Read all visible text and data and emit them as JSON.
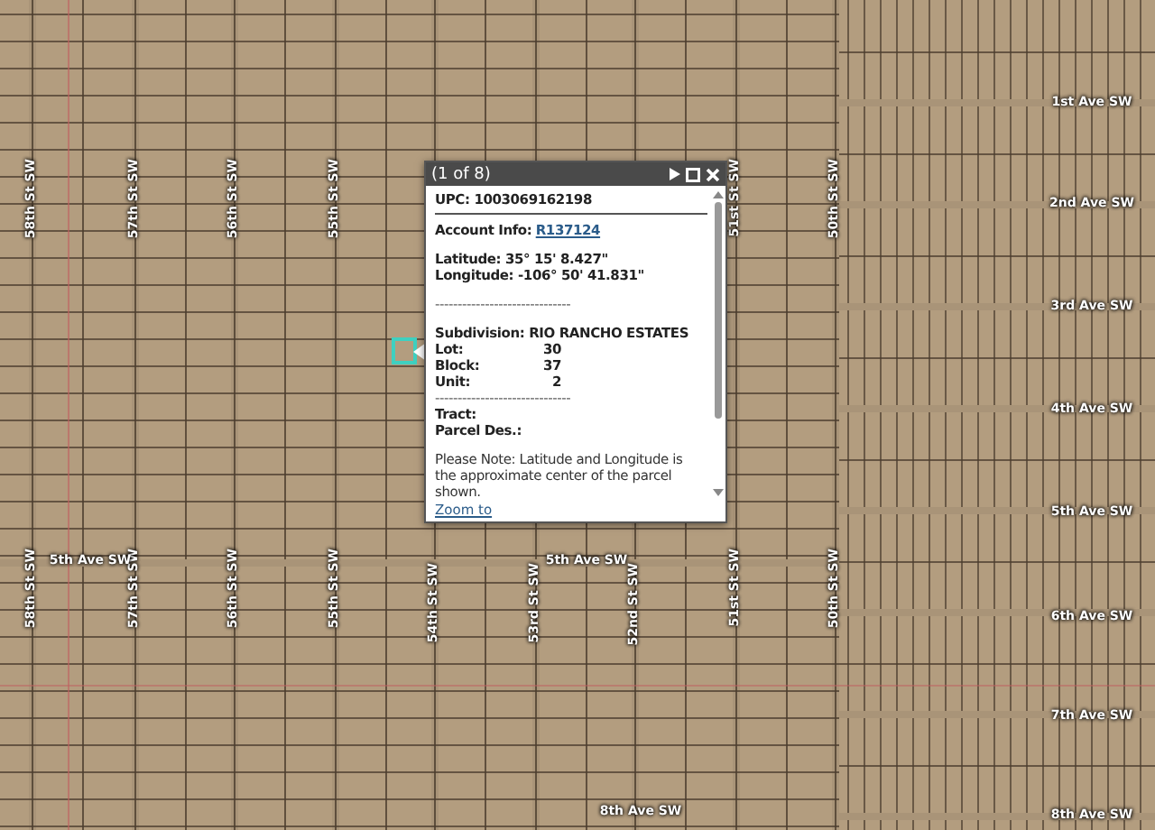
{
  "map": {
    "street_labels_upper": [
      "58th St SW",
      "57th St SW",
      "56th St SW",
      "55th St SW",
      "51st St SW",
      "50th St SW"
    ],
    "street_labels_lower": [
      "58th St SW",
      "57th St SW",
      "56th St SW",
      "55th St SW",
      "54th St SW",
      "53rd St SW",
      "52nd St SW",
      "51st St SW",
      "50th St SW"
    ],
    "avenue_labels": [
      "1st Ave SW",
      "2nd Ave SW",
      "3rd Ave SW",
      "4th Ave SW",
      "5th Ave SW",
      "6th Ave SW",
      "7th Ave SW",
      "8th Ave SW",
      "5th Ave SW",
      "5th Ave SW",
      "8th Ave SW"
    ]
  },
  "popup": {
    "title": "(1 of 8)",
    "rows": [
      {
        "kind": "field",
        "label": "UPC:",
        "value": "1003069162198"
      },
      {
        "kind": "rule"
      },
      {
        "kind": "link",
        "label": "Account Info:",
        "value": "R137124"
      },
      {
        "kind": "gap"
      },
      {
        "kind": "field",
        "label": "Latitude:",
        "value": "35° 15' 8.427\""
      },
      {
        "kind": "field",
        "label": "Longitude:",
        "value": "-106° 50' 41.831\""
      },
      {
        "kind": "gap"
      },
      {
        "kind": "dashes",
        "text": "------------------------------"
      },
      {
        "kind": "gap"
      },
      {
        "kind": "field",
        "label": "Subdivision:",
        "value": "RIO RANCHO ESTATES"
      },
      {
        "kind": "pair",
        "label": "Lot:",
        "value": "30"
      },
      {
        "kind": "pair",
        "label": "Block:",
        "value": "37"
      },
      {
        "kind": "pair",
        "label": "Unit:",
        "value": "2"
      },
      {
        "kind": "dashes",
        "text": "------------------------------"
      },
      {
        "kind": "field",
        "label": "Tract:",
        "value": ""
      },
      {
        "kind": "field",
        "label": "Parcel Des.:",
        "value": ""
      },
      {
        "kind": "gap"
      },
      {
        "kind": "note",
        "text": "Please Note: Latitude and Longitude is the approximate center of the parcel shown."
      }
    ],
    "footer_link": "Zoom to"
  }
}
